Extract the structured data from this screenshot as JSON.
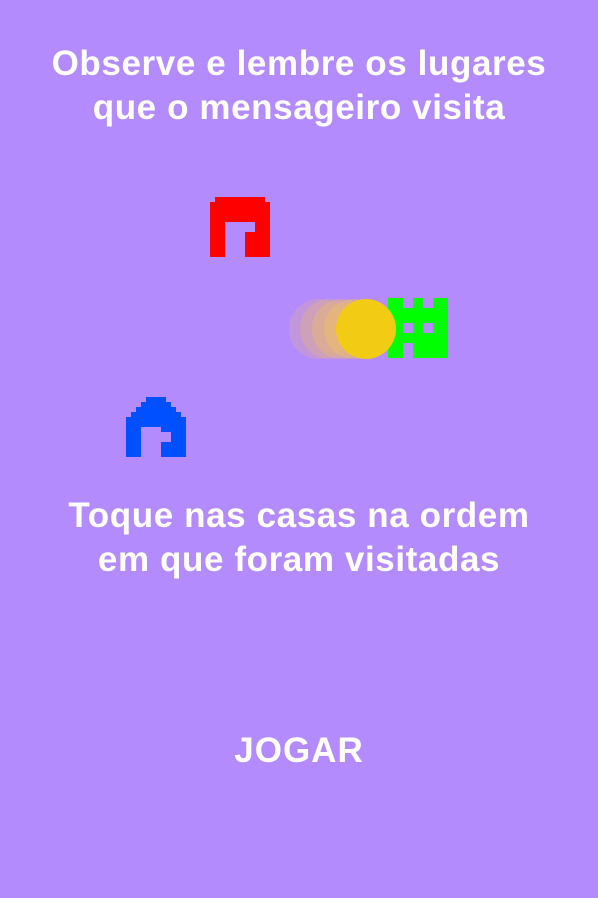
{
  "colors": {
    "background": "#b48bfd",
    "text": "#ffffff",
    "house_red": "#ff0000",
    "house_green": "#00ff00",
    "house_blue": "#0050ff",
    "messenger": "#f2cb14",
    "messenger_trail": "#f0c060"
  },
  "instructions": {
    "top_line_1": "Observe e lembre os lugares",
    "top_line_2": "que o mensageiro visita",
    "bottom_line_1": "Toque nas casas na ordem",
    "bottom_line_2": "em que foram visitadas"
  },
  "houses": [
    {
      "color_name": "red",
      "icon": "house-icon"
    },
    {
      "color_name": "green",
      "icon": "castle-icon"
    },
    {
      "color_name": "blue",
      "icon": "house-icon"
    }
  ],
  "messenger": {
    "icon": "circle-ball-icon",
    "trail": "motion-trail"
  },
  "play_button": {
    "label": "JOGAR"
  }
}
